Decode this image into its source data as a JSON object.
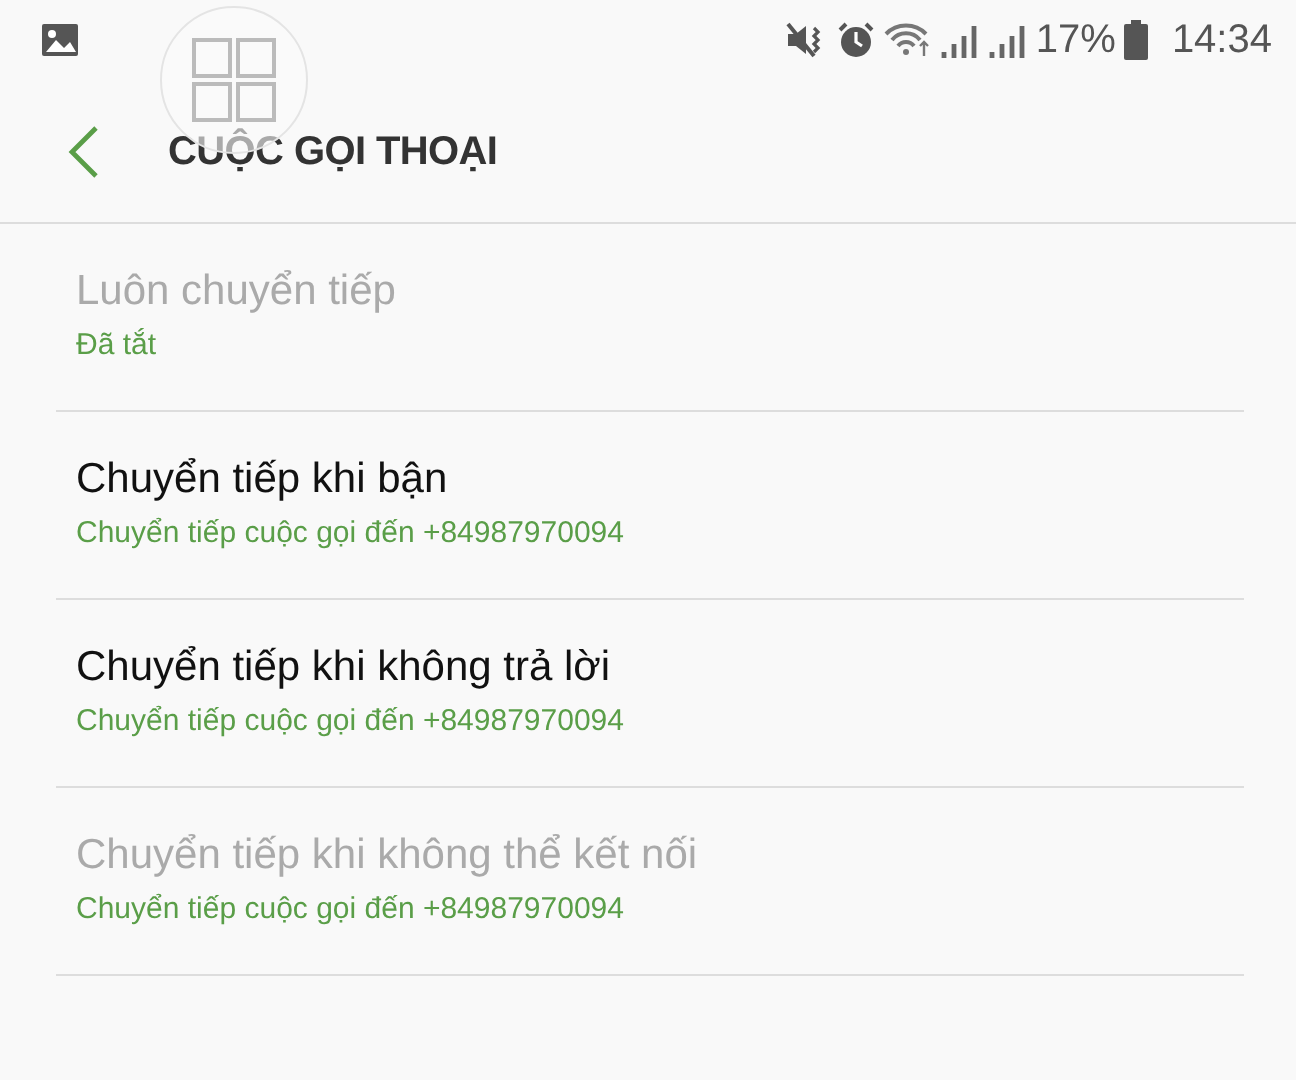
{
  "status_bar": {
    "battery": "17%",
    "time": "14:34"
  },
  "header": {
    "title": "CUỘC GỌI THOẠI"
  },
  "items": [
    {
      "title": "Luôn chuyển tiếp",
      "summary": "Đã tắt",
      "disabled": true
    },
    {
      "title": "Chuyển tiếp khi bận",
      "summary": "Chuyển tiếp cuộc gọi đến +84987970094",
      "disabled": false
    },
    {
      "title": "Chuyển tiếp khi không trả lời",
      "summary": "Chuyển tiếp cuộc gọi đến +84987970094",
      "disabled": false
    },
    {
      "title": "Chuyển tiếp khi không thể kết nối",
      "summary": "Chuyển tiếp cuộc gọi đến +84987970094",
      "disabled": true
    }
  ]
}
